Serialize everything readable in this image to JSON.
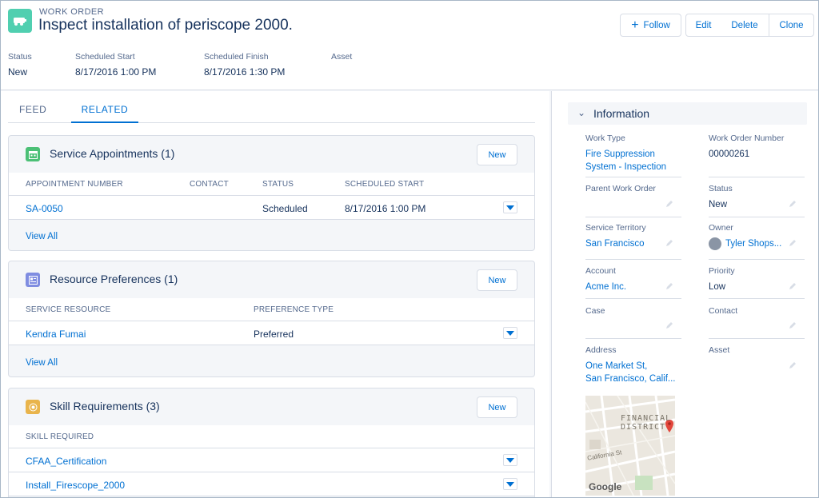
{
  "header": {
    "object_type": "WORK ORDER",
    "title": "Inspect installation of periscope 2000.",
    "buttons": {
      "follow": "Follow",
      "edit": "Edit",
      "delete": "Delete",
      "clone": "Clone"
    },
    "highlights": [
      {
        "label": "Status",
        "value": "New"
      },
      {
        "label": "Scheduled Start",
        "value": "8/17/2016 1:00 PM"
      },
      {
        "label": "Scheduled Finish",
        "value": "8/17/2016 1:30 PM"
      },
      {
        "label": "Asset",
        "value": ""
      }
    ],
    "icon_color": "#50cfb0"
  },
  "tabs": {
    "feed": "FEED",
    "related": "RELATED",
    "active": "RELATED"
  },
  "cards": {
    "service_appointments": {
      "title": "Service Appointments (1)",
      "new_label": "New",
      "columns": [
        "APPOINTMENT NUMBER",
        "CONTACT",
        "STATUS",
        "SCHEDULED START"
      ],
      "rows": [
        {
          "number": "SA-0050",
          "contact": "",
          "status": "Scheduled",
          "start": "8/17/2016 1:00 PM"
        }
      ],
      "view_all": "View All",
      "icon": "calendar-icon",
      "icon_color": "#4bc076"
    },
    "resource_preferences": {
      "title": "Resource Preferences (1)",
      "new_label": "New",
      "columns": [
        "SERVICE RESOURCE",
        "PREFERENCE TYPE"
      ],
      "rows": [
        {
          "resource": "Kendra Fumai",
          "type": "Preferred"
        }
      ],
      "view_all": "View All",
      "icon": "resource-icon",
      "icon_color": "#7f8de1"
    },
    "skill_requirements": {
      "title": "Skill Requirements (3)",
      "new_label": "New",
      "columns": [
        "SKILL REQUIRED"
      ],
      "rows": [
        {
          "skill": "CFAA_Certification"
        },
        {
          "skill": "Install_Firescope_2000"
        }
      ],
      "icon": "skill-icon",
      "icon_color": "#e9b44c"
    }
  },
  "info": {
    "title": "Information",
    "fields": {
      "work_type": {
        "label": "Work Type",
        "value": "Fire Suppression System - Inspection"
      },
      "work_order_number": {
        "label": "Work Order Number",
        "value": "00000261"
      },
      "parent_work_order": {
        "label": "Parent Work Order",
        "value": ""
      },
      "status": {
        "label": "Status",
        "value": "New"
      },
      "service_territory": {
        "label": "Service Territory",
        "value": "San Francisco"
      },
      "owner": {
        "label": "Owner",
        "value": "Tyler Shops..."
      },
      "account": {
        "label": "Account",
        "value": "Acme Inc."
      },
      "priority": {
        "label": "Priority",
        "value": "Low"
      },
      "case": {
        "label": "Case",
        "value": ""
      },
      "contact": {
        "label": "Contact",
        "value": ""
      },
      "address": {
        "label": "Address",
        "line1": "One Market St,",
        "line2": "San Francisco, Calif..."
      },
      "asset": {
        "label": "Asset",
        "value": ""
      }
    },
    "map": {
      "district": "FINANCIAL",
      "district2": "DISTRICT",
      "street": "California St",
      "brand": "Google"
    }
  },
  "colors": {
    "link": "#0070d2",
    "text": "#16325c",
    "muted": "#54698d",
    "border": "#d8dde6"
  }
}
